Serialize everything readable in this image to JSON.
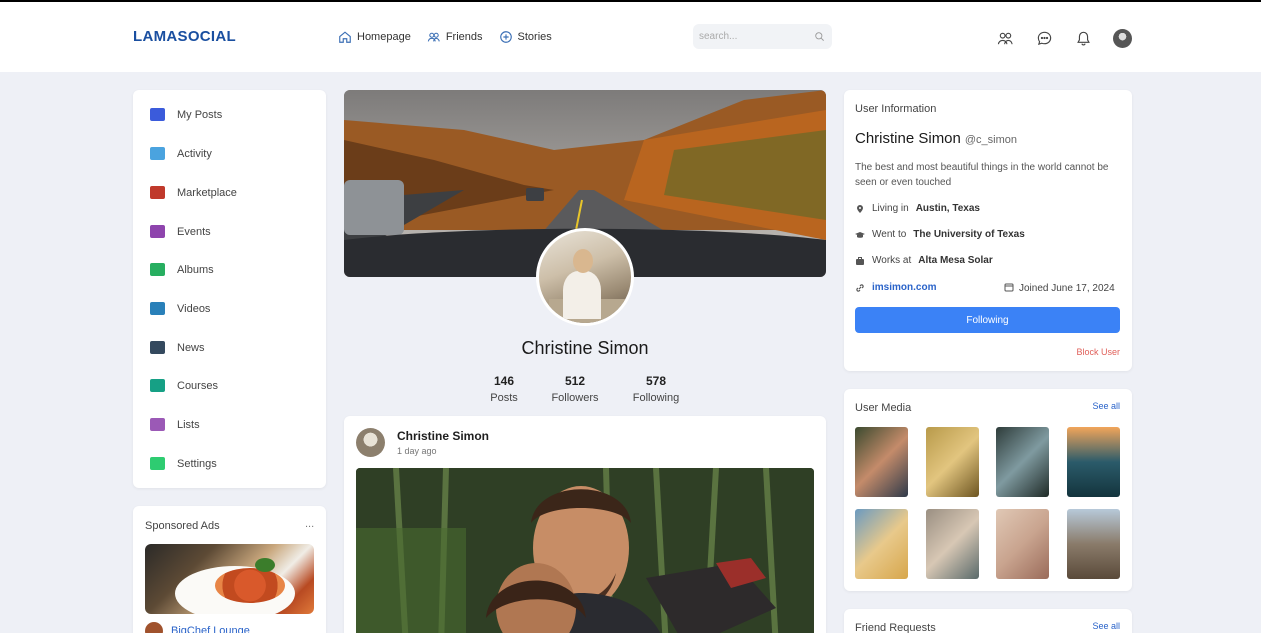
{
  "app": {
    "logo": "LAMASOCIAL"
  },
  "nav": {
    "links": [
      {
        "label": "Homepage",
        "icon": "home-icon"
      },
      {
        "label": "Friends",
        "icon": "friends-icon"
      },
      {
        "label": "Stories",
        "icon": "stories-icon"
      }
    ],
    "search_placeholder": "search...",
    "icons": [
      "people-icon",
      "messages-icon",
      "notifications-icon",
      "user-avatar"
    ]
  },
  "left_menu": {
    "items": [
      {
        "label": "My Posts",
        "icon": "posts-icon",
        "color": "#3b5bdb"
      },
      {
        "label": "Activity",
        "icon": "activity-icon",
        "color": "#4aa3df"
      },
      {
        "label": "Marketplace",
        "icon": "marketplace-icon",
        "color": "#c0392b"
      },
      {
        "label": "Events",
        "icon": "events-icon",
        "color": "#8e44ad"
      },
      {
        "label": "Albums",
        "icon": "albums-icon",
        "color": "#27ae60"
      },
      {
        "label": "Videos",
        "icon": "videos-icon",
        "color": "#2980b9"
      },
      {
        "label": "News",
        "icon": "news-icon",
        "color": "#34495e"
      },
      {
        "label": "Courses",
        "icon": "courses-icon",
        "color": "#16a085"
      },
      {
        "label": "Lists",
        "icon": "lists-icon",
        "color": "#9b59b6"
      },
      {
        "label": "Settings",
        "icon": "settings-icon",
        "color": "#2ecc71"
      }
    ]
  },
  "ads": {
    "title": "Sponsored Ads",
    "more": "...",
    "brand": "BigChef Lounge"
  },
  "profile": {
    "name": "Christine Simon",
    "stats": [
      {
        "num": "146",
        "label": "Posts"
      },
      {
        "num": "512",
        "label": "Followers"
      },
      {
        "num": "578",
        "label": "Following"
      }
    ]
  },
  "post": {
    "author": "Christine Simon",
    "time": "1 day ago"
  },
  "user_info": {
    "title": "User Information",
    "name": "Christine Simon",
    "username": "@c_simon",
    "description": "The best and most beautiful things in the world cannot be seen or even touched",
    "living_prefix": "Living in",
    "living": "Austin, Texas",
    "school_prefix": "Went to",
    "school": "The University of Texas",
    "work_prefix": "Works at",
    "work": "Alta Mesa Solar",
    "website": "imsimon.com",
    "joined": "Joined June 17, 2024",
    "follow_button": "Following",
    "block": "Block User"
  },
  "user_media": {
    "title": "User Media",
    "see_all": "See all",
    "items": [
      "media-1",
      "media-2",
      "media-3",
      "media-4",
      "media-5",
      "media-6",
      "media-7",
      "media-8"
    ]
  },
  "friend_requests": {
    "title": "Friend Requests",
    "see_all": "See all"
  },
  "colors": {
    "brand": "#1a4fa0",
    "accent": "#3b82f6",
    "link": "#2a63c9",
    "danger": "#e0605a",
    "background": "#eef0f6"
  }
}
